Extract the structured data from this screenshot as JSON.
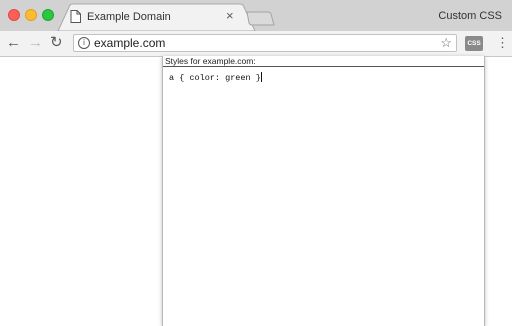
{
  "window": {
    "traffic_lights": [
      "close",
      "minimize",
      "maximize"
    ],
    "colors": {
      "close": "#fc5f57",
      "minimize": "#fdbc2e",
      "maximize": "#28c840"
    }
  },
  "tab": {
    "title": "Example Domain",
    "icon": "page-icon",
    "close_label": "×"
  },
  "profile_label": "Custom CSS",
  "toolbar": {
    "back_icon": "←",
    "forward_icon": "→",
    "reload_icon": "↻",
    "url": "example.com",
    "info_icon": "i",
    "bookmark_icon": "☆",
    "extension_label": "CSS",
    "menu_icon": "⋮"
  },
  "popup": {
    "header": "Styles for example.com:",
    "editor_text": "a { color: green }"
  }
}
